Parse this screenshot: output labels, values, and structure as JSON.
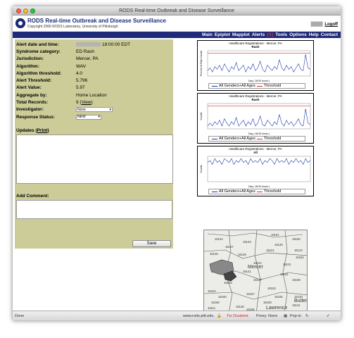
{
  "window": {
    "title": "RODS Real-time Outbreak and Disease Surveillance"
  },
  "header": {
    "app_name": "RODS Real-time Outbreak and Disease Surveillance",
    "copyright": "Copyright 2006 RODS Laboratory, University of Pittsburgh",
    "logoff_label": "Logoff"
  },
  "nav": {
    "items": [
      "Main",
      "Epiplot",
      "Mapplot",
      "Alerts",
      "(A)",
      "Tools",
      "Options",
      "Help",
      "Contact"
    ]
  },
  "alert": {
    "labels": {
      "date": "Alert date and time:",
      "category": "Syndrome category:",
      "jurisdiction": "Jurisdiction:",
      "algorithm": "Algorithm:",
      "threshold_algo": "Algorithm threshold:",
      "threshold": "Alert Threshold:",
      "value": "Alert Value:",
      "aggregate": "Aggregate by:",
      "records": "Total Records:",
      "investigator": "Investigator:",
      "response": "Response Status:"
    },
    "values": {
      "date": "18:00:00 EDT",
      "category": "ED Rash",
      "jurisdiction": "Mercer, PA",
      "algorithm": "WAV",
      "threshold_algo": "4.0",
      "threshold": "5.796",
      "value": "5.97",
      "aggregate": "Home Location",
      "records": "9",
      "view_link": "View",
      "investigator": "None",
      "response": "NEW"
    },
    "updates_label": "Updates",
    "print_label": "Print",
    "comment_label": "Add Comment:",
    "save_label": "Save"
  },
  "charts": [
    {
      "title": "Healthcare Registrations - Mercer, PA",
      "subtitle": "Rash",
      "xlabel": "Day ( 18:00 hours )",
      "ylabel": "Percent of Total Counts",
      "legend_series": "All Genders+All Ages",
      "legend_threshold": "Threshold"
    },
    {
      "title": "Healthcare Registrations - Mercer, PA",
      "subtitle": "Rash",
      "xlabel": "Day ( 18:00 hours )",
      "ylabel": "Counts",
      "legend_series": "All Genders+All Ages",
      "legend_threshold": "Threshold"
    },
    {
      "title": "Healthcare Registrations - Mercer, PA",
      "subtitle": "All",
      "xlabel": "Day ( 18:00 hours )",
      "ylabel": "Counts",
      "legend_series": "All Genders+All Ages",
      "legend_threshold": "Threshold"
    }
  ],
  "chart_data": [
    {
      "type": "line",
      "title": "Healthcare Registrations - Mercer, PA",
      "subtitle": "Rash",
      "ylabel": "Percent of Total Counts",
      "xlabel": "Day ( 18:00 hours )",
      "series": [
        {
          "name": "All Genders+All Ages",
          "values": [
            4,
            6,
            3,
            7,
            5,
            8,
            4,
            9,
            6,
            3,
            7,
            5,
            10,
            4,
            6,
            8,
            3,
            7,
            5,
            9,
            4,
            6,
            11,
            5,
            3,
            8,
            6,
            4,
            7,
            5,
            12,
            6,
            4,
            8,
            5,
            7,
            3,
            6,
            9,
            5,
            4,
            16,
            6,
            5
          ]
        },
        {
          "name": "Threshold",
          "values": [
            17,
            17,
            17,
            17,
            17,
            17,
            17,
            17,
            17,
            17,
            17,
            17,
            17,
            17,
            17,
            17,
            17,
            17,
            17,
            17,
            17,
            17,
            17,
            17,
            17,
            17,
            17,
            17,
            17,
            17,
            17,
            17,
            17,
            17,
            17,
            17,
            17,
            17,
            17,
            17,
            17,
            17,
            17,
            17
          ]
        }
      ]
    },
    {
      "type": "line",
      "title": "Healthcare Registrations - Mercer, PA",
      "subtitle": "Rash",
      "ylabel": "Counts",
      "xlabel": "Day ( 18:00 hours )",
      "series": [
        {
          "name": "All Genders+All Ages",
          "values": [
            2,
            4,
            2,
            5,
            3,
            6,
            2,
            7,
            4,
            2,
            5,
            3,
            8,
            2,
            4,
            6,
            2,
            5,
            3,
            7,
            2,
            4,
            9,
            3,
            2,
            6,
            4,
            2,
            5,
            3,
            10,
            4,
            2,
            6,
            3,
            5,
            2,
            4,
            7,
            3,
            2,
            14,
            4,
            3
          ]
        },
        {
          "name": "Threshold",
          "values": [
            16,
            16,
            16,
            16,
            16,
            16,
            16,
            16,
            16,
            16,
            16,
            16,
            16,
            16,
            16,
            16,
            16,
            16,
            16,
            16,
            16,
            16,
            16,
            16,
            16,
            16,
            16,
            16,
            16,
            16,
            16,
            16,
            16,
            16,
            16,
            16,
            16,
            16,
            16,
            16,
            16,
            16,
            16,
            16
          ]
        }
      ]
    },
    {
      "type": "line",
      "title": "Healthcare Registrations - Mercer, PA",
      "subtitle": "All",
      "ylabel": "Counts",
      "xlabel": "Day ( 18:00 hours )",
      "series": [
        {
          "name": "All Genders+All Ages",
          "values": [
            10,
            11,
            9,
            12,
            10,
            11,
            9,
            12,
            11,
            10,
            12,
            9,
            11,
            10,
            12,
            10,
            11,
            9,
            12,
            10,
            11,
            10,
            12,
            9,
            11,
            10,
            12,
            11,
            9,
            12,
            10,
            11,
            10,
            12,
            9,
            11,
            10,
            12,
            10,
            11,
            9,
            12,
            10,
            11
          ]
        },
        {
          "name": "Threshold",
          "values": []
        }
      ]
    }
  ],
  "map": {
    "labels": [
      "16134",
      "16133",
      "16124",
      "16125",
      "16137",
      "16121",
      "16146",
      "16148",
      "16150",
      "16151",
      "16145",
      "16153",
      "16154",
      "16127",
      "16156",
      "16159",
      "16130",
      "16131",
      "16113",
      "16111",
      "16141",
      "16142",
      "16143",
      "16155",
      "16157",
      "16158",
      "16160",
      "16161",
      "16162",
      "16165",
      "Mercer",
      "Lawrence",
      "Butler"
    ]
  },
  "status": {
    "done": "Done",
    "domain": "www.rods.pitt.edu",
    "tor": "Tor Disabled",
    "proxy": "Proxy: None",
    "popin": "Pop-in"
  },
  "colors": {
    "nav_bg": "#1f2b78",
    "panel_bg": "#cccc99",
    "alert_red": "#e03535",
    "series": "#1a3aa8",
    "threshold": "#d03030"
  }
}
